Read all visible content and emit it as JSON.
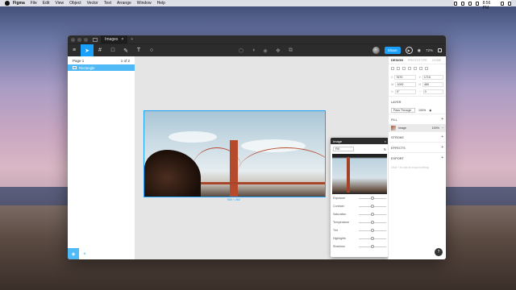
{
  "menubar": {
    "app": "Figma",
    "items": [
      "File",
      "Edit",
      "View",
      "Object",
      "Vector",
      "Text",
      "Arrange",
      "Window",
      "Help"
    ],
    "clock": "Sat 8:56 PM"
  },
  "window": {
    "tab_title": "Images"
  },
  "toolbar": {
    "share_label": "Share",
    "zoom": "72%"
  },
  "layers": {
    "page_label": "Page 1",
    "page_count": "1 of 2",
    "items": [
      {
        "label": "Rectangle"
      }
    ]
  },
  "canvas": {
    "selection_size": "540 × 260"
  },
  "popup": {
    "title": "Image",
    "mode": "Fill",
    "pin_label": "100%",
    "adjust": [
      "Exposure",
      "Contrast",
      "Saturation",
      "Temperature",
      "Tint",
      "Highlights",
      "Shadows"
    ],
    "slider_fractions": [
      0.5,
      0.5,
      0.5,
      0.5,
      0.5,
      0.5,
      0.5
    ]
  },
  "properties": {
    "tabs": [
      "DESIGN",
      "PROTOTYPE",
      "CODE"
    ],
    "fields": [
      {
        "k": "X",
        "v": "7670"
      },
      {
        "k": "Y",
        "v": "1715"
      },
      {
        "k": "W",
        "v": "1000"
      },
      {
        "k": "H",
        "v": "480"
      },
      {
        "k": "↻",
        "v": "0°"
      },
      {
        "k": "◠",
        "v": "0"
      }
    ],
    "layer_title": "LAYER",
    "blend": "Pass Through",
    "opacity": "100%",
    "fill_title": "FILL",
    "fill_type": "Image",
    "fill_opacity": "100%",
    "stroke_title": "STROKE",
    "effects_title": "EFFECTS",
    "export_title": "EXPORT",
    "export_hint": "Click + to add an export setting"
  }
}
